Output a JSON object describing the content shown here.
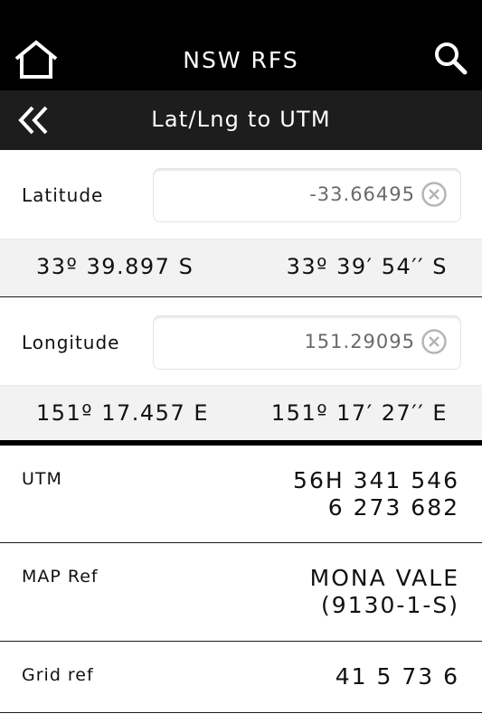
{
  "header": {
    "title": "NSW RFS",
    "home_icon": "home-icon",
    "search_icon": "search-icon"
  },
  "subheader": {
    "title": "Lat/Lng to UTM",
    "back_icon": "double-chevron-left-icon"
  },
  "latitude": {
    "label": "Latitude",
    "value": "-33.66495",
    "degrees_minutes": "33º 39.897 S",
    "degrees_minutes_seconds": "33º 39′ 54′′ S"
  },
  "longitude": {
    "label": "Longitude",
    "value": "151.29095",
    "degrees_minutes": "151º 17.457 E",
    "degrees_minutes_seconds": "151º 17′ 27′′ E"
  },
  "results": {
    "utm": {
      "label": "UTM",
      "line1": "56H 341 546",
      "line2": "6 273 682"
    },
    "map_ref": {
      "label": "MAP Ref",
      "line1": "MONA VALE",
      "line2": "(9130-1-S)"
    },
    "grid_ref": {
      "label": "Grid ref",
      "value": "41 5 73 6"
    }
  },
  "colors": {
    "topbar": "#000000",
    "subbar": "#1d1d1d",
    "conversion_bg": "#f2f2f2",
    "input_text": "#6a6a6a"
  }
}
